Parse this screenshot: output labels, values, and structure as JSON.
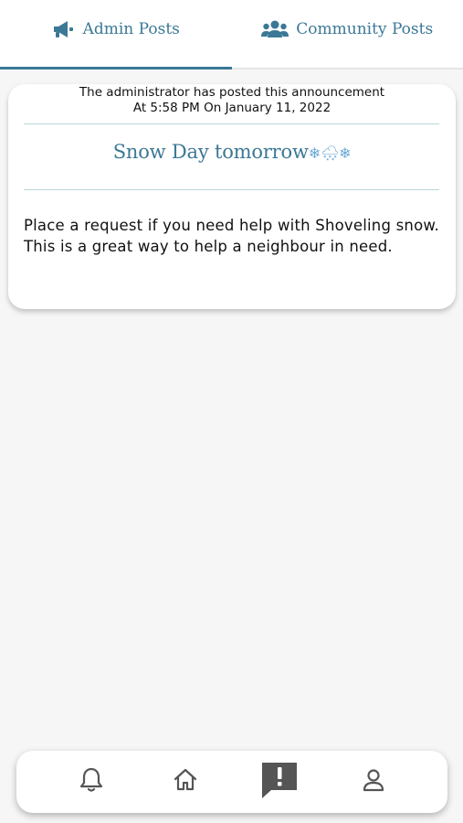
{
  "tabs": [
    {
      "label": "Admin Posts",
      "icon": "megaphone-icon",
      "active": true
    },
    {
      "label": "Community Posts",
      "icon": "users-icon",
      "active": false
    }
  ],
  "post": {
    "meta_line1": "The administrator has posted this announcement",
    "meta_line2": "At 5:58 PM On January 11, 2022",
    "title": "Snow Day tomorrow",
    "title_emoji": "❄🌨❄",
    "body": "Place a request if you need help with Shoveling snow. This is a great way to help a neighbour in need."
  },
  "bottom_nav": [
    {
      "icon": "bell-icon",
      "active": false
    },
    {
      "icon": "home-icon",
      "active": false
    },
    {
      "icon": "alert-chat-icon",
      "active": true
    },
    {
      "icon": "user-icon",
      "active": false
    }
  ],
  "colors": {
    "accent": "#3b7896",
    "background": "#f6f6f6",
    "divider": "#bcd4d8",
    "nav_icon": "#555555"
  }
}
